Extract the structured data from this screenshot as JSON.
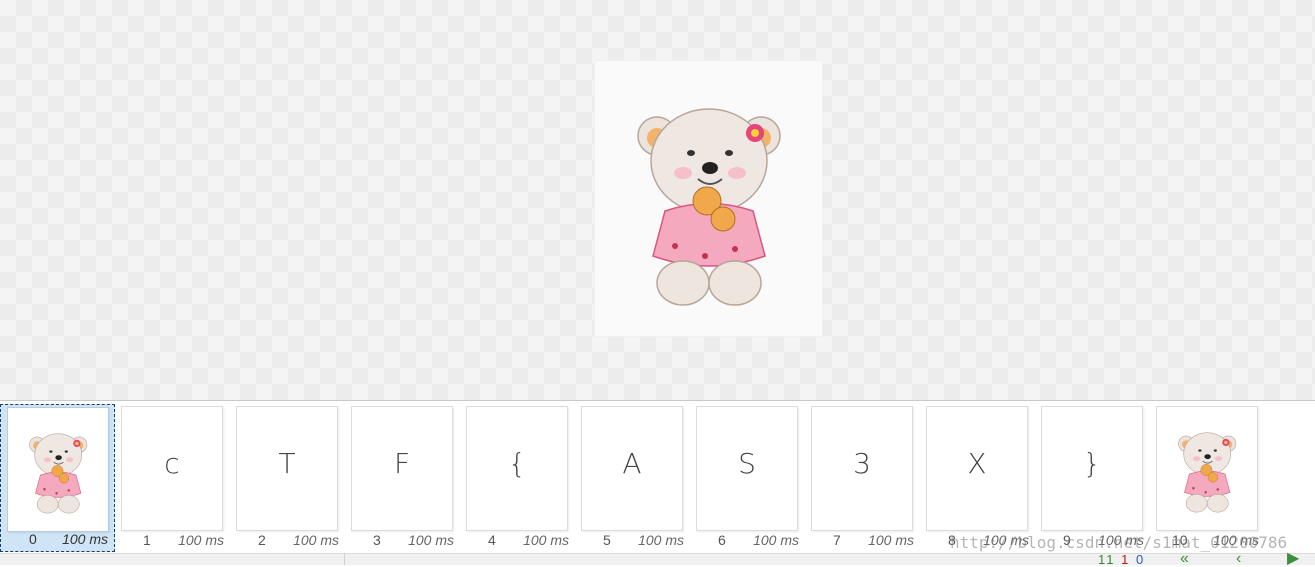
{
  "frames": [
    {
      "index": "0",
      "duration": "100 ms",
      "kind": "image",
      "selected": true
    },
    {
      "index": "1",
      "duration": "100 ms",
      "kind": "text",
      "glyph": "c"
    },
    {
      "index": "2",
      "duration": "100 ms",
      "kind": "text",
      "glyph": "T"
    },
    {
      "index": "3",
      "duration": "100 ms",
      "kind": "text",
      "glyph": "F"
    },
    {
      "index": "4",
      "duration": "100 ms",
      "kind": "text",
      "glyph": "{"
    },
    {
      "index": "5",
      "duration": "100 ms",
      "kind": "text",
      "glyph": "A"
    },
    {
      "index": "6",
      "duration": "100 ms",
      "kind": "text",
      "glyph": "S"
    },
    {
      "index": "7",
      "duration": "100 ms",
      "kind": "text",
      "glyph": "3"
    },
    {
      "index": "8",
      "duration": "100 ms",
      "kind": "text",
      "glyph": "X"
    },
    {
      "index": "9",
      "duration": "100 ms",
      "kind": "text",
      "glyph": "}"
    },
    {
      "index": "10",
      "duration": "100 ms",
      "kind": "image"
    }
  ],
  "status": {
    "count_a": "11",
    "count_b": "1",
    "count_c": "0"
  },
  "watermark": "http://blog.csdn.net/s1mat_01200786",
  "icons": {
    "preview": "teddy-bear-image",
    "nav_first": "double-chevron-left-icon",
    "nav_prev": "chevron-left-icon",
    "nav_next": "play-right-icon"
  },
  "colors": {
    "selection_fill": "#cfe5f5",
    "selection_border": "#1b3d66",
    "count_a": "#2e8b2e",
    "count_b": "#c01818",
    "count_c": "#1e5fc8"
  }
}
